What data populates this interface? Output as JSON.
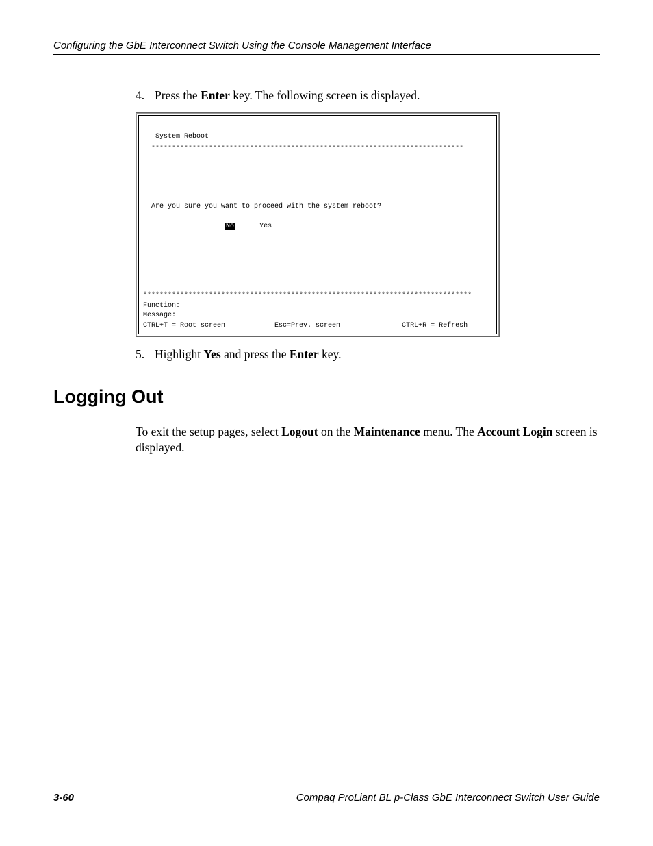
{
  "header": {
    "title": "Configuring the GbE Interconnect Switch Using the Console Management Interface"
  },
  "steps": {
    "step4": {
      "num": "4.",
      "t1": "Press the ",
      "b1": "Enter",
      "t2": " key. The following screen is displayed."
    },
    "step5": {
      "num": "5.",
      "t1": "Highlight ",
      "b1": "Yes",
      "t2": " and press the ",
      "b2": "Enter",
      "t3": " key."
    }
  },
  "console": {
    "title": "   System Reboot",
    "hr": "  ----------------------------------------------------------------------------",
    "blank": " ",
    "prompt": "  Are you sure you want to proceed with the system reboot?",
    "opts_prefix": "                    ",
    "no": "No",
    "opts_mid": "      ",
    "yes": "Yes",
    "stars": "********************************************************************************",
    "func": "Function:",
    "msg": "Message:",
    "help": "CTRL+T = Root screen            Esc=Prev. screen               CTRL+R = Refresh"
  },
  "section": {
    "title": "Logging Out"
  },
  "body": {
    "p1a": "To exit the setup pages, select ",
    "p1b": "Logout",
    "p1c": " on the ",
    "p1d": "Maintenance",
    "p1e": " menu. The ",
    "p1f": "Account Login",
    "p1g": " screen is displayed."
  },
  "footer": {
    "left": "3-60",
    "right": "Compaq ProLiant BL p-Class GbE Interconnect Switch User Guide"
  }
}
